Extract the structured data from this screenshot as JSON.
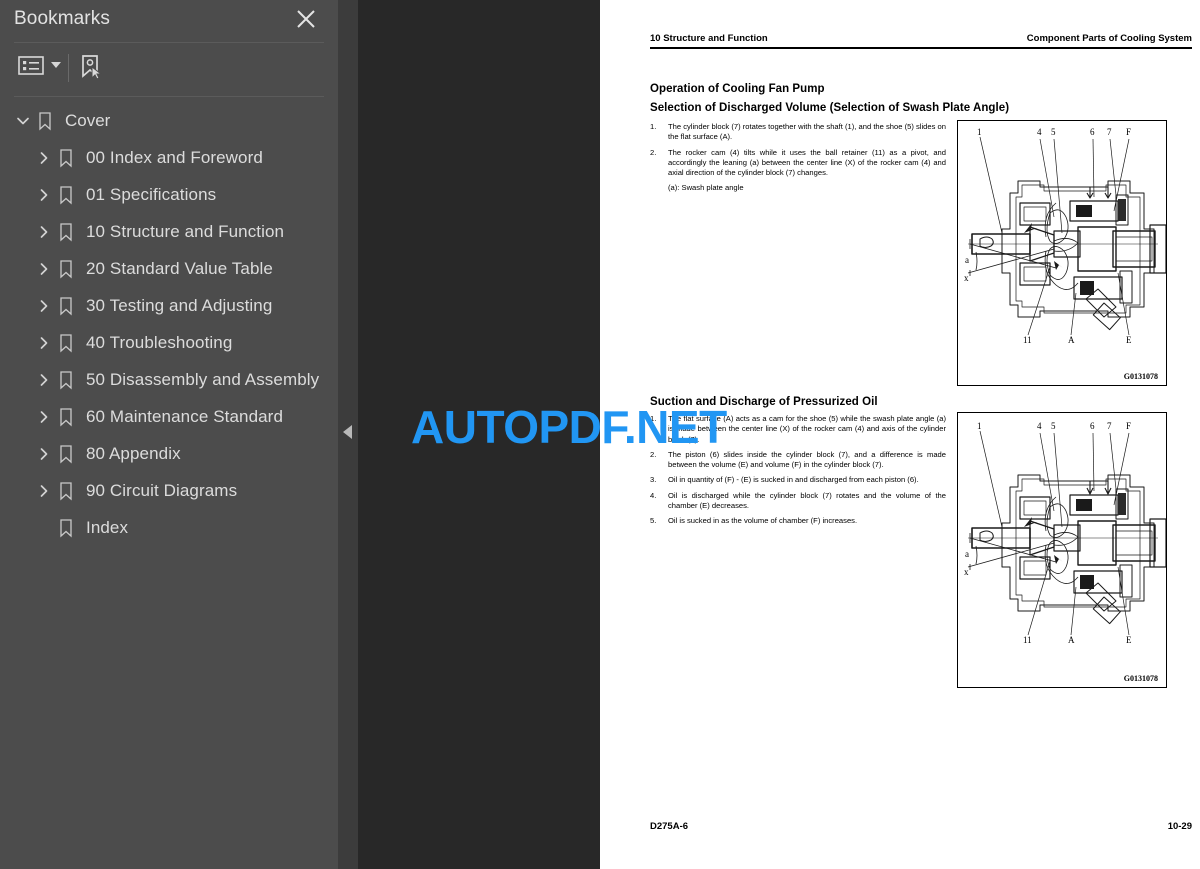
{
  "sidebar": {
    "title": "Bookmarks",
    "close_icon": "close-icon",
    "toolbar": {
      "options_icon": "list-options-icon",
      "new_bookmark_icon": "new-bookmark-icon"
    },
    "tree": [
      {
        "label": "Cover",
        "depth": 0,
        "state": "expanded",
        "icon": "bookmark-icon"
      },
      {
        "label": "00 Index and Foreword",
        "depth": 1,
        "state": "collapsed",
        "icon": "bookmark-icon"
      },
      {
        "label": "01 Specifications",
        "depth": 1,
        "state": "collapsed",
        "icon": "bookmark-icon"
      },
      {
        "label": "10 Structure and Function",
        "depth": 1,
        "state": "collapsed",
        "icon": "bookmark-icon"
      },
      {
        "label": "20 Standard Value Table",
        "depth": 1,
        "state": "collapsed",
        "icon": "bookmark-icon"
      },
      {
        "label": "30 Testing and Adjusting",
        "depth": 1,
        "state": "collapsed",
        "icon": "bookmark-icon"
      },
      {
        "label": "40 Troubleshooting",
        "depth": 1,
        "state": "collapsed",
        "icon": "bookmark-icon"
      },
      {
        "label": "50 Disassembly and Assembly",
        "depth": 1,
        "state": "collapsed",
        "icon": "bookmark-icon"
      },
      {
        "label": "60 Maintenance Standard",
        "depth": 1,
        "state": "collapsed",
        "icon": "bookmark-icon"
      },
      {
        "label": "80 Appendix",
        "depth": 1,
        "state": "collapsed",
        "icon": "bookmark-icon"
      },
      {
        "label": "90 Circuit Diagrams",
        "depth": 1,
        "state": "collapsed",
        "icon": "bookmark-icon"
      },
      {
        "label": "Index",
        "depth": 1,
        "state": "leaf",
        "icon": "bookmark-icon"
      }
    ]
  },
  "splitter": {
    "collapse_icon": "collapse-left-icon"
  },
  "viewer": {
    "watermark": "AUTOPDF.NET",
    "watermark_color": "#2196f3",
    "background_color": "#282828"
  },
  "page": {
    "header_left": "10 Structure and Function",
    "header_right": "Component Parts of Cooling System",
    "footer_left": "D275A-6",
    "footer_right": "10-29",
    "title_operation": "Operation of Cooling Fan Pump",
    "title_selection": "Selection of Discharged Volume (Selection of Swash Plate Angle)",
    "title_suction": "Suction and Discharge of Pressurized Oil",
    "list_selection": [
      {
        "num": "1.",
        "text": "The cylinder block (7) rotates together with the shaft (1), and the shoe (5) slides on the flat surface (A).",
        "sub": ""
      },
      {
        "num": "2.",
        "text": "The rocker cam (4) tilts while it uses the ball retainer (11) as a pivot, and accordingly the leaning (a) between the center line (X) of the rocker cam (4) and axial direction of the cylinder block (7) changes.",
        "sub": "(a): Swash plate angle"
      }
    ],
    "list_suction": [
      {
        "num": "1.",
        "text": "The flat surface (A) acts as a cam for the shoe (5) while the swash plate angle (a) is made between the center line (X) of the rocker cam (4) and axis of the cylinder block (7).",
        "sub": ""
      },
      {
        "num": "2.",
        "text": "The piston (6) slides inside the cylinder block (7), and a difference is made between the volume (E) and volume (F) in the cylinder block (7).",
        "sub": ""
      },
      {
        "num": "3.",
        "text": "Oil in quantity of (F) - (E) is sucked in and discharged from each piston (6).",
        "sub": ""
      },
      {
        "num": "4.",
        "text": "Oil is discharged while the cylinder block (7) rotates and the volume of the chamber (E) decreases.",
        "sub": ""
      },
      {
        "num": "5.",
        "text": "Oil is sucked in as the volume of chamber (F) increases.",
        "sub": ""
      }
    ],
    "figure1": {
      "id": "G0131078",
      "callouts": [
        "1",
        "4",
        "5",
        "6",
        "7",
        "F",
        "a",
        "x",
        "11",
        "A",
        "E"
      ]
    },
    "figure2": {
      "id": "G0131078",
      "callouts": [
        "1",
        "4",
        "5",
        "6",
        "7",
        "F",
        "a",
        "x",
        "11",
        "A",
        "E"
      ]
    }
  }
}
